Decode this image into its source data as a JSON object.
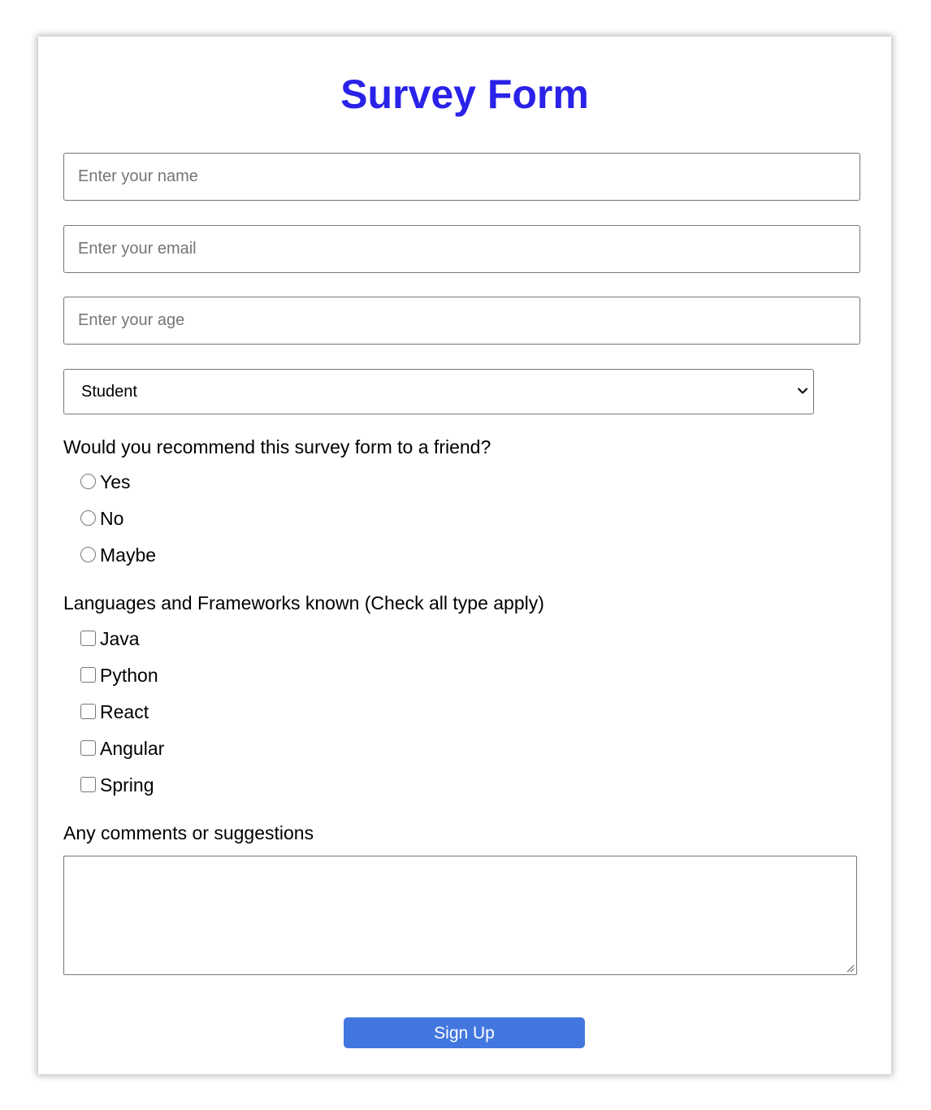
{
  "form": {
    "title": "Survey Form",
    "title_color": "#2a22e8",
    "name_field": {
      "placeholder": "Enter your name",
      "value": ""
    },
    "email_field": {
      "placeholder": "Enter your email",
      "value": ""
    },
    "age_field": {
      "placeholder": "Enter your age",
      "value": ""
    },
    "role_select": {
      "selected": "Student",
      "icon": "chevron-down-icon"
    },
    "recommend": {
      "question": "Would you recommend this survey form to a friend?",
      "options": [
        {
          "label": "Yes",
          "checked": false
        },
        {
          "label": "No",
          "checked": false
        },
        {
          "label": "Maybe",
          "checked": false
        }
      ]
    },
    "languages": {
      "question": "Languages and Frameworks known (Check all type apply)",
      "options": [
        {
          "label": "Java",
          "checked": false
        },
        {
          "label": "Python",
          "checked": false
        },
        {
          "label": "React",
          "checked": false
        },
        {
          "label": "Angular",
          "checked": false
        },
        {
          "label": "Spring",
          "checked": false
        }
      ]
    },
    "comments": {
      "label": "Any comments or suggestions",
      "value": ""
    },
    "submit": {
      "label": "Sign Up",
      "color": "#4377e0"
    }
  }
}
